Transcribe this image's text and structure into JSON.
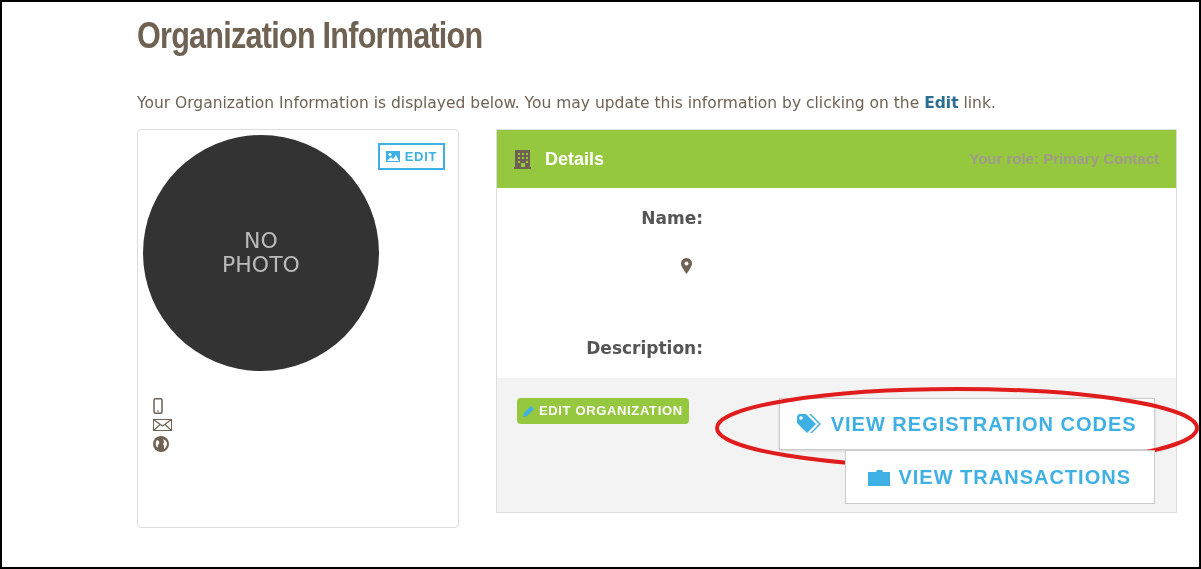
{
  "title": "Organization Information",
  "intro": {
    "before": "Your Organization Information is displayed below. You may update this information by clicking on the ",
    "link": "Edit",
    "after": " link."
  },
  "profile": {
    "photo_text": "NO PHOTO",
    "edit_button": "EDIT"
  },
  "details": {
    "title": "Details",
    "role": "Your role: Primary Contact",
    "fields": [
      {
        "kind": "label",
        "label": "Name:"
      },
      {
        "kind": "icon"
      },
      {
        "kind": "label",
        "label": "Description:"
      }
    ]
  },
  "actions": {
    "edit_button": "EDIT ORGANIZATION",
    "links": [
      {
        "label": "VIEW REGISTRATION CODES",
        "kind": "tags",
        "highlighted": true
      },
      {
        "label": "VIEW TRANSACTIONS",
        "kind": "folder",
        "highlighted": false
      }
    ]
  }
}
